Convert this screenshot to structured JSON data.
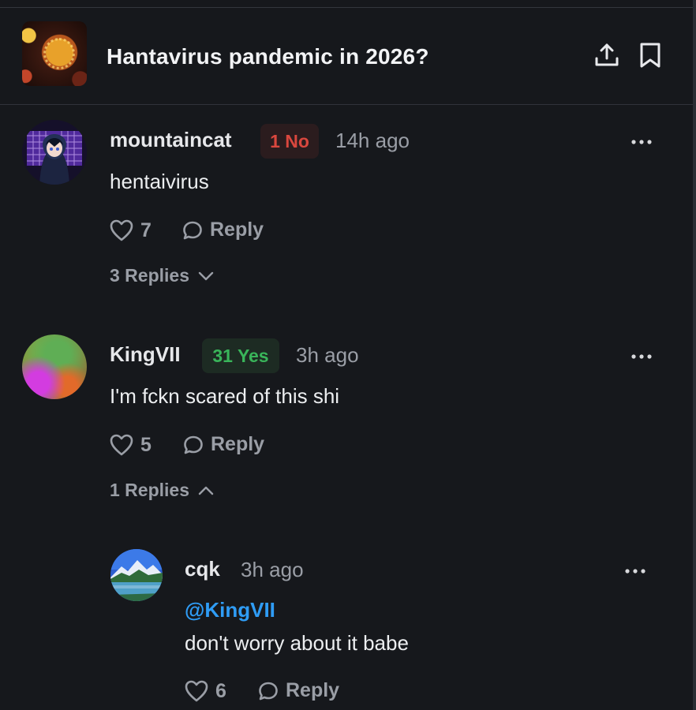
{
  "header": {
    "title": "Hantavirus pandemic in 2026?",
    "share_icon": "share-upload-icon",
    "bookmark_icon": "bookmark-icon"
  },
  "comments": [
    {
      "username": "mountaincat",
      "badge": "1 No",
      "badge_type": "no",
      "time": "14h ago",
      "text": "hentaivirus",
      "likes": "7",
      "reply_label": "Reply",
      "replies_label": "3 Replies",
      "replies_expanded": false
    },
    {
      "username": "KingVII",
      "badge": "31 Yes",
      "badge_type": "yes",
      "time": "3h ago",
      "text": "I'm fckn scared of this shi",
      "likes": "5",
      "reply_label": "Reply",
      "replies_label": "1 Replies",
      "replies_expanded": true
    }
  ],
  "reply": {
    "username": "cqk",
    "time": "3h ago",
    "mention": "@KingVII",
    "text": "don't worry about it babe",
    "likes": "6",
    "reply_label": "Reply"
  },
  "colors": {
    "background": "#16181c",
    "no_red": "#d9473e",
    "yes_green": "#39b55a",
    "mention_blue": "#2f9cf5",
    "muted": "#9a9ea6"
  }
}
